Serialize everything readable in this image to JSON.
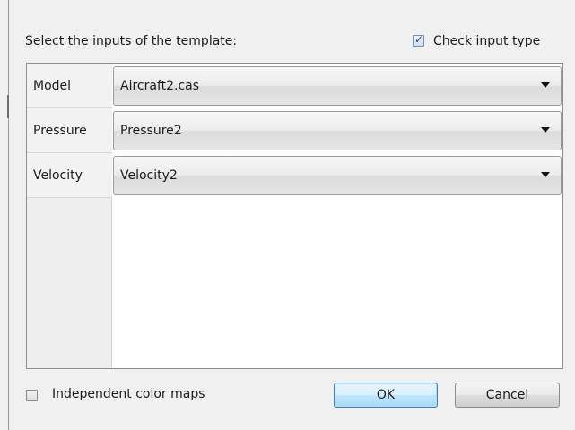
{
  "dialog": {
    "header_label": "Select the inputs of the template:",
    "check_input_type": {
      "label": "Check input type",
      "checked": true
    },
    "inputs": [
      {
        "name": "Model",
        "value": "Aircraft2.cas"
      },
      {
        "name": "Pressure",
        "value": "Pressure2"
      },
      {
        "name": "Velocity",
        "value": "Velocity2"
      }
    ],
    "independent_color_maps": {
      "label": "Independent color maps",
      "checked": false
    },
    "buttons": {
      "ok_label": "OK",
      "cancel_label": "Cancel"
    },
    "colors": {
      "background": "#f0f0f0",
      "default_button_border": "#3c7fb1",
      "checkbox_accent": "#6f8fb7"
    },
    "icons": {
      "checkmark": "checkmark-icon",
      "dropdown": "dropdown-arrow-icon"
    }
  }
}
